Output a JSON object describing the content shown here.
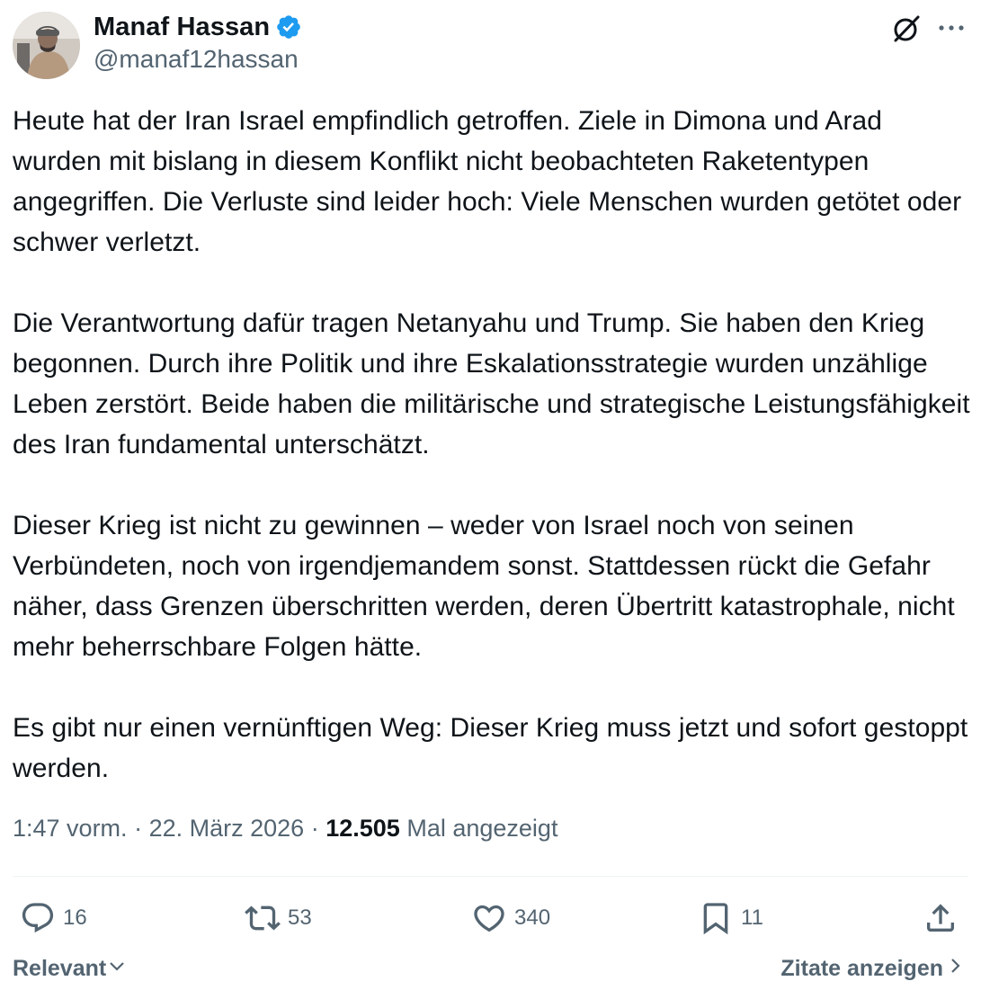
{
  "author": {
    "display_name": "Manaf Hassan",
    "handle": "@manaf12hassan",
    "verified": true
  },
  "tweet": {
    "paragraphs": [
      "Heute hat der Iran Israel empfindlich getroffen. Ziele in Dimona und Arad wurden mit bislang in diesem Konflikt nicht beobachteten Raketentypen angegriffen. Die Verluste sind leider hoch: Viele Menschen wurden getötet oder schwer verletzt.",
      "Die Verantwortung dafür tragen Netanyahu und Trump. Sie haben den Krieg begonnen. Durch ihre Politik und ihre Eskalationsstrategie wurden unzählige Leben zerstört. Beide haben die militärische und strategische Leistungsfähigkeit des Iran fundamental unterschätzt.",
      "Dieser Krieg ist nicht zu gewinnen – weder von Israel noch von seinen Verbündeten, noch von irgendjemandem sonst. Stattdessen rückt die Gefahr näher, dass Grenzen überschritten werden, deren Übertritt katastrophale, nicht mehr beherrschbare Folgen hätte.",
      "Es gibt nur einen vernünftigen Weg: Dieser Krieg muss jetzt und sofort gestoppt werden."
    ]
  },
  "meta": {
    "time": "1:47 vorm.",
    "separator": "·",
    "date": "22. März 2026",
    "views_count": "12.505",
    "views_label": "Mal angezeigt"
  },
  "actions": {
    "replies": "16",
    "reposts": "53",
    "likes": "340",
    "bookmarks": "11"
  },
  "footer": {
    "sort_label": "Relevant",
    "quotes_label": "Zitate anzeigen"
  },
  "icons": {
    "verified": "verified-badge-icon",
    "grok": "grok-icon",
    "more": "more-dots-icon",
    "reply": "reply-icon",
    "repost": "repost-icon",
    "like": "heart-icon",
    "bookmark": "bookmark-icon",
    "share": "share-icon",
    "sort": "chevron-down-icon",
    "quotes": "chevron-right-icon"
  },
  "colors": {
    "text": "#0f1419",
    "secondary": "#536471",
    "verified": "#1d9bf0",
    "divider": "#eff3f4"
  }
}
